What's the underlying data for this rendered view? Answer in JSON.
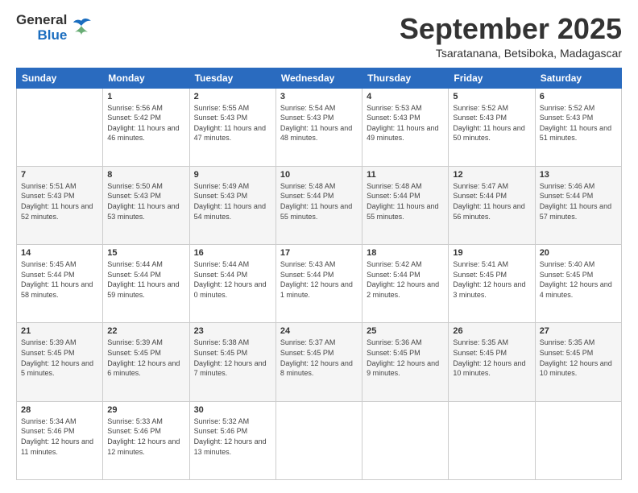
{
  "logo": {
    "line1": "General",
    "line2": "Blue"
  },
  "header": {
    "month": "September 2025",
    "location": "Tsaratanana, Betsiboka, Madagascar"
  },
  "columns": [
    "Sunday",
    "Monday",
    "Tuesday",
    "Wednesday",
    "Thursday",
    "Friday",
    "Saturday"
  ],
  "weeks": [
    [
      {
        "day": "",
        "sunrise": "",
        "sunset": "",
        "daylight": ""
      },
      {
        "day": "1",
        "sunrise": "Sunrise: 5:56 AM",
        "sunset": "Sunset: 5:42 PM",
        "daylight": "Daylight: 11 hours and 46 minutes."
      },
      {
        "day": "2",
        "sunrise": "Sunrise: 5:55 AM",
        "sunset": "Sunset: 5:43 PM",
        "daylight": "Daylight: 11 hours and 47 minutes."
      },
      {
        "day": "3",
        "sunrise": "Sunrise: 5:54 AM",
        "sunset": "Sunset: 5:43 PM",
        "daylight": "Daylight: 11 hours and 48 minutes."
      },
      {
        "day": "4",
        "sunrise": "Sunrise: 5:53 AM",
        "sunset": "Sunset: 5:43 PM",
        "daylight": "Daylight: 11 hours and 49 minutes."
      },
      {
        "day": "5",
        "sunrise": "Sunrise: 5:52 AM",
        "sunset": "Sunset: 5:43 PM",
        "daylight": "Daylight: 11 hours and 50 minutes."
      },
      {
        "day": "6",
        "sunrise": "Sunrise: 5:52 AM",
        "sunset": "Sunset: 5:43 PM",
        "daylight": "Daylight: 11 hours and 51 minutes."
      }
    ],
    [
      {
        "day": "7",
        "sunrise": "Sunrise: 5:51 AM",
        "sunset": "Sunset: 5:43 PM",
        "daylight": "Daylight: 11 hours and 52 minutes."
      },
      {
        "day": "8",
        "sunrise": "Sunrise: 5:50 AM",
        "sunset": "Sunset: 5:43 PM",
        "daylight": "Daylight: 11 hours and 53 minutes."
      },
      {
        "day": "9",
        "sunrise": "Sunrise: 5:49 AM",
        "sunset": "Sunset: 5:43 PM",
        "daylight": "Daylight: 11 hours and 54 minutes."
      },
      {
        "day": "10",
        "sunrise": "Sunrise: 5:48 AM",
        "sunset": "Sunset: 5:44 PM",
        "daylight": "Daylight: 11 hours and 55 minutes."
      },
      {
        "day": "11",
        "sunrise": "Sunrise: 5:48 AM",
        "sunset": "Sunset: 5:44 PM",
        "daylight": "Daylight: 11 hours and 55 minutes."
      },
      {
        "day": "12",
        "sunrise": "Sunrise: 5:47 AM",
        "sunset": "Sunset: 5:44 PM",
        "daylight": "Daylight: 11 hours and 56 minutes."
      },
      {
        "day": "13",
        "sunrise": "Sunrise: 5:46 AM",
        "sunset": "Sunset: 5:44 PM",
        "daylight": "Daylight: 11 hours and 57 minutes."
      }
    ],
    [
      {
        "day": "14",
        "sunrise": "Sunrise: 5:45 AM",
        "sunset": "Sunset: 5:44 PM",
        "daylight": "Daylight: 11 hours and 58 minutes."
      },
      {
        "day": "15",
        "sunrise": "Sunrise: 5:44 AM",
        "sunset": "Sunset: 5:44 PM",
        "daylight": "Daylight: 11 hours and 59 minutes."
      },
      {
        "day": "16",
        "sunrise": "Sunrise: 5:44 AM",
        "sunset": "Sunset: 5:44 PM",
        "daylight": "Daylight: 12 hours and 0 minutes."
      },
      {
        "day": "17",
        "sunrise": "Sunrise: 5:43 AM",
        "sunset": "Sunset: 5:44 PM",
        "daylight": "Daylight: 12 hours and 1 minute."
      },
      {
        "day": "18",
        "sunrise": "Sunrise: 5:42 AM",
        "sunset": "Sunset: 5:44 PM",
        "daylight": "Daylight: 12 hours and 2 minutes."
      },
      {
        "day": "19",
        "sunrise": "Sunrise: 5:41 AM",
        "sunset": "Sunset: 5:45 PM",
        "daylight": "Daylight: 12 hours and 3 minutes."
      },
      {
        "day": "20",
        "sunrise": "Sunrise: 5:40 AM",
        "sunset": "Sunset: 5:45 PM",
        "daylight": "Daylight: 12 hours and 4 minutes."
      }
    ],
    [
      {
        "day": "21",
        "sunrise": "Sunrise: 5:39 AM",
        "sunset": "Sunset: 5:45 PM",
        "daylight": "Daylight: 12 hours and 5 minutes."
      },
      {
        "day": "22",
        "sunrise": "Sunrise: 5:39 AM",
        "sunset": "Sunset: 5:45 PM",
        "daylight": "Daylight: 12 hours and 6 minutes."
      },
      {
        "day": "23",
        "sunrise": "Sunrise: 5:38 AM",
        "sunset": "Sunset: 5:45 PM",
        "daylight": "Daylight: 12 hours and 7 minutes."
      },
      {
        "day": "24",
        "sunrise": "Sunrise: 5:37 AM",
        "sunset": "Sunset: 5:45 PM",
        "daylight": "Daylight: 12 hours and 8 minutes."
      },
      {
        "day": "25",
        "sunrise": "Sunrise: 5:36 AM",
        "sunset": "Sunset: 5:45 PM",
        "daylight": "Daylight: 12 hours and 9 minutes."
      },
      {
        "day": "26",
        "sunrise": "Sunrise: 5:35 AM",
        "sunset": "Sunset: 5:45 PM",
        "daylight": "Daylight: 12 hours and 10 minutes."
      },
      {
        "day": "27",
        "sunrise": "Sunrise: 5:35 AM",
        "sunset": "Sunset: 5:45 PM",
        "daylight": "Daylight: 12 hours and 10 minutes."
      }
    ],
    [
      {
        "day": "28",
        "sunrise": "Sunrise: 5:34 AM",
        "sunset": "Sunset: 5:46 PM",
        "daylight": "Daylight: 12 hours and 11 minutes."
      },
      {
        "day": "29",
        "sunrise": "Sunrise: 5:33 AM",
        "sunset": "Sunset: 5:46 PM",
        "daylight": "Daylight: 12 hours and 12 minutes."
      },
      {
        "day": "30",
        "sunrise": "Sunrise: 5:32 AM",
        "sunset": "Sunset: 5:46 PM",
        "daylight": "Daylight: 12 hours and 13 minutes."
      },
      {
        "day": "",
        "sunrise": "",
        "sunset": "",
        "daylight": ""
      },
      {
        "day": "",
        "sunrise": "",
        "sunset": "",
        "daylight": ""
      },
      {
        "day": "",
        "sunrise": "",
        "sunset": "",
        "daylight": ""
      },
      {
        "day": "",
        "sunrise": "",
        "sunset": "",
        "daylight": ""
      }
    ]
  ]
}
